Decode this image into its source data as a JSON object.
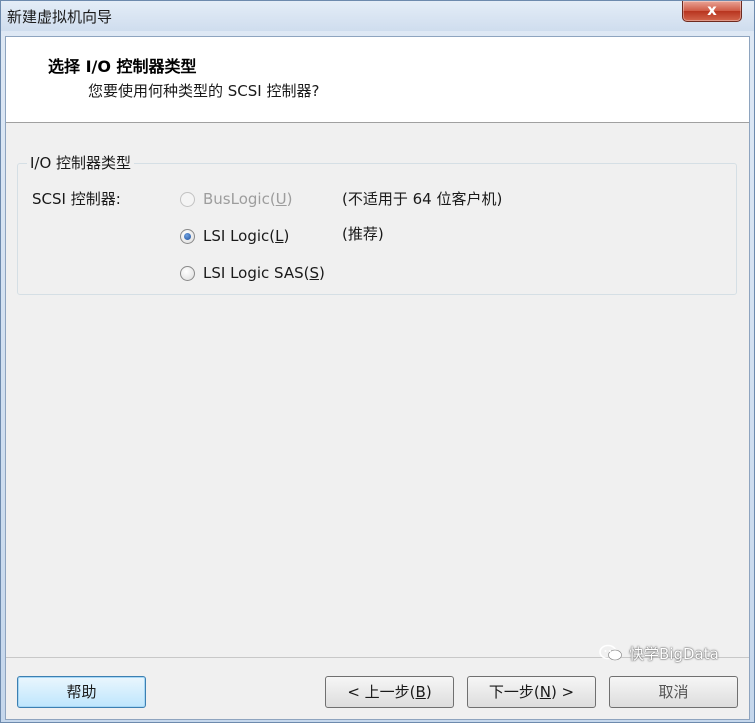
{
  "window": {
    "title": "新建虚拟机向导",
    "close_glyph": "x"
  },
  "header": {
    "title": "选择 I/O 控制器类型",
    "subtitle": "您要使用何种类型的 SCSI 控制器?"
  },
  "group": {
    "legend": "I/O 控制器类型",
    "field_label": "SCSI 控制器:",
    "options": [
      {
        "label_pre": "BusLogic(",
        "mnemonic": "U",
        "label_post": ")",
        "note": "(不适用于 64 位客户机)",
        "checked": false,
        "enabled": false
      },
      {
        "label_pre": "LSI Logic(",
        "mnemonic": "L",
        "label_post": ")",
        "note": "(推荐)",
        "checked": true,
        "enabled": true
      },
      {
        "label_pre": "LSI Logic SAS(",
        "mnemonic": "S",
        "label_post": ")",
        "note": "",
        "checked": false,
        "enabled": true
      }
    ]
  },
  "footer": {
    "help": "帮助",
    "back": {
      "pre": "< 上一步(",
      "mnemonic": "B",
      "post": ")"
    },
    "next": {
      "pre": "下一步(",
      "mnemonic": "N",
      "post": ") >"
    },
    "cancel": "取消"
  },
  "watermark": {
    "text": "快学BigData",
    "icon": "wechat-icon"
  },
  "colors": {
    "accent_border": "#3c7fb1",
    "disabled_text": "#9d9d9d",
    "close_red": "#c94b35"
  }
}
